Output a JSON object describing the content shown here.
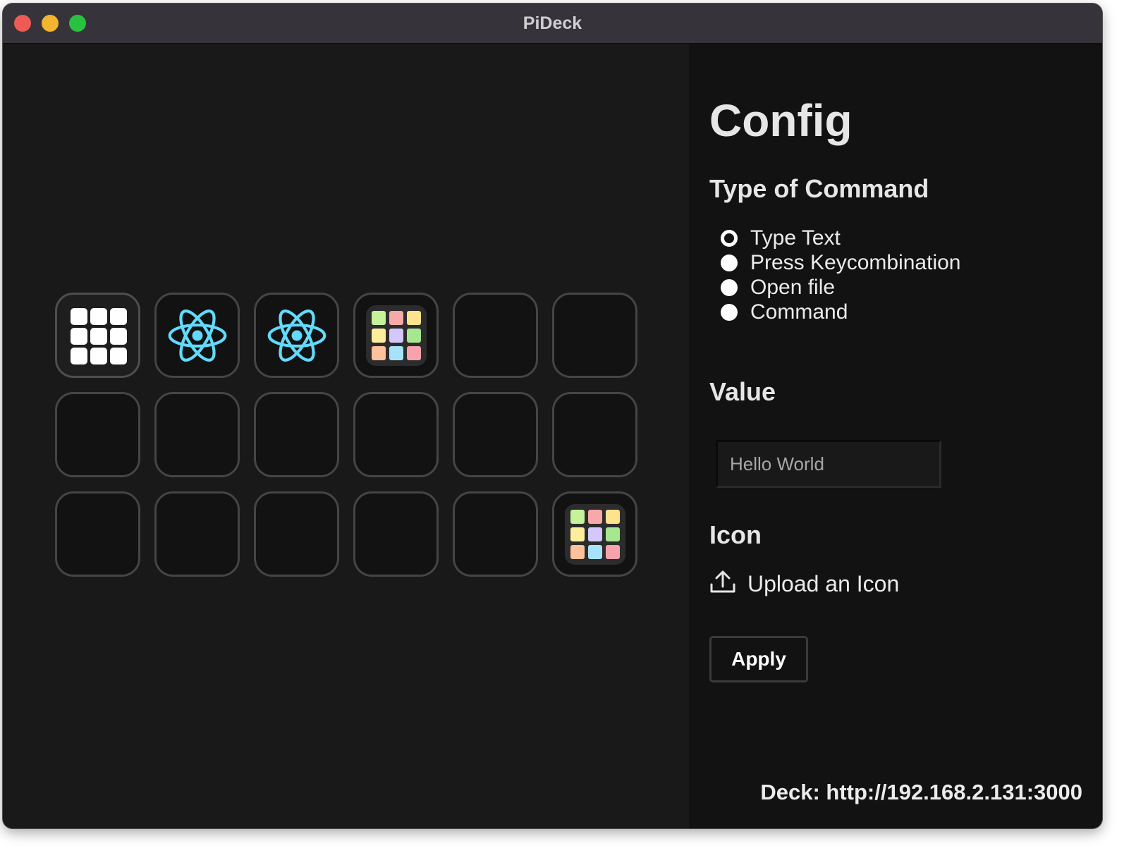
{
  "window": {
    "title": "PiDeck"
  },
  "deck": {
    "rows": 3,
    "columns": 6,
    "buttons": [
      {
        "icon": "grid-icon"
      },
      {
        "icon": "react-icon"
      },
      {
        "icon": "react-icon"
      },
      {
        "icon": "launchpad-icon"
      },
      {
        "icon": ""
      },
      {
        "icon": ""
      },
      {
        "icon": ""
      },
      {
        "icon": ""
      },
      {
        "icon": ""
      },
      {
        "icon": ""
      },
      {
        "icon": ""
      },
      {
        "icon": ""
      },
      {
        "icon": ""
      },
      {
        "icon": ""
      },
      {
        "icon": ""
      },
      {
        "icon": ""
      },
      {
        "icon": ""
      },
      {
        "icon": "launchpad-icon"
      }
    ]
  },
  "config": {
    "heading": "Config",
    "type_heading": "Type of Command",
    "command_types": [
      {
        "label": "Type Text",
        "selected": true
      },
      {
        "label": "Press Keycombination",
        "selected": false
      },
      {
        "label": "Open file",
        "selected": false
      },
      {
        "label": "Command",
        "selected": false
      }
    ],
    "value_heading": "Value",
    "value_placeholder": "Hello World",
    "value": "",
    "icon_heading": "Icon",
    "upload_label": "Upload an Icon",
    "apply_label": "Apply",
    "deck_url": "Deck: http://192.168.2.131:3000"
  },
  "colors": {
    "react": "#61dafb",
    "launchpad_tiles": [
      "#c6f29a",
      "#f7a8a8",
      "#fde38d",
      "#fdee9c",
      "#d4c7fb",
      "#a6e88f",
      "#fdc29b",
      "#a6e3fb",
      "#f7a3ad"
    ]
  }
}
